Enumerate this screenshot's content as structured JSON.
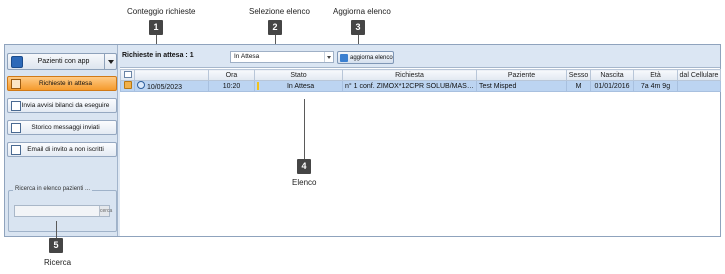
{
  "callouts": [
    {
      "num": "1",
      "label": "Conteggio richieste"
    },
    {
      "num": "2",
      "label": "Selezione elenco"
    },
    {
      "num": "3",
      "label": "Aggiorna elenco"
    },
    {
      "num": "4",
      "label": "Elenco"
    },
    {
      "num": "5",
      "label": "Ricerca"
    }
  ],
  "sidebar": {
    "profile_label": "Pazienti con app",
    "items": [
      {
        "label": "Richieste in attesa",
        "active": true
      },
      {
        "label": "Invia avvisi bilanci da eseguire",
        "active": false
      },
      {
        "label": "Storico messaggi inviati",
        "active": false
      },
      {
        "label": "Email di invito a non iscritti",
        "active": false
      }
    ],
    "search_title": "Ricerca in elenco pazienti ...",
    "search_value": "",
    "search_button": "cerca"
  },
  "toolbar": {
    "count_label": "Richieste in attesa : 1",
    "list_selected": "In Attesa",
    "refresh_label": "aggiorna elenco"
  },
  "table": {
    "headers": [
      "",
      "",
      "Ora",
      "Stato",
      "Richiesta",
      "Paziente",
      "Sesso",
      "Nascita",
      "Età",
      "dal Cellulare"
    ],
    "rows": [
      {
        "date": "10/05/2023",
        "time": "10:20",
        "status": "In Attesa",
        "request": "n° 1 conf. ZIMOX*12CPR SOLUB/MAST ...",
        "patient": "Test Misped",
        "sex": "M",
        "birth": "01/01/2016",
        "age": "7a 4m 9g",
        "from_mobile": ""
      }
    ]
  }
}
